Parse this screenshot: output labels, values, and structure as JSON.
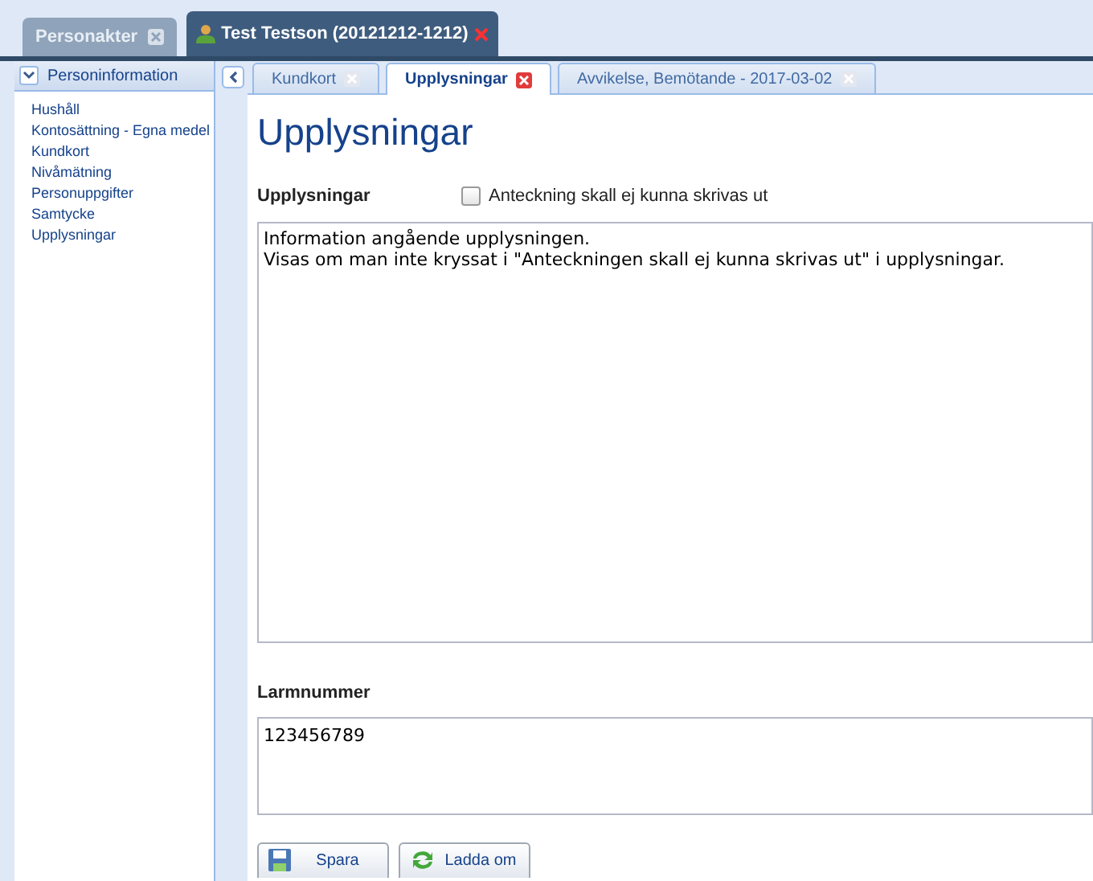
{
  "outer_tabs": [
    {
      "label": "Personakter",
      "selected": false,
      "kind": "plain"
    },
    {
      "label": "Test Testson (20121212-1212)",
      "selected": true,
      "kind": "person"
    }
  ],
  "sidebar": {
    "title": "Personinformation",
    "items": [
      "Hushåll",
      "Kontosättning - Egna medel",
      "Kundkort",
      "Nivåmätning",
      "Personuppgifter",
      "Samtycke",
      "Upplysningar"
    ]
  },
  "inner_tabs": [
    {
      "label": "Kundkort",
      "selected": false
    },
    {
      "label": "Upplysningar",
      "selected": true
    },
    {
      "label": "Avvikelse, Bemötande - 2017-03-02",
      "selected": false
    }
  ],
  "heading": "Upplysningar",
  "section_label": "Upplysningar",
  "checkbox": {
    "label": "Anteckning skall ej kunna skrivas ut",
    "checked": false
  },
  "notes": "Information angående upplysningen.\nVisas om man inte kryssat i \"Anteckningen skall ej kunna skrivas ut\" i upplysningar.",
  "alarm_label": "Larmnummer",
  "alarm_value": "123456789",
  "buttons": [
    {
      "label": "Spara",
      "kind": "save"
    },
    {
      "label": "Ladda om",
      "kind": "reload"
    }
  ]
}
